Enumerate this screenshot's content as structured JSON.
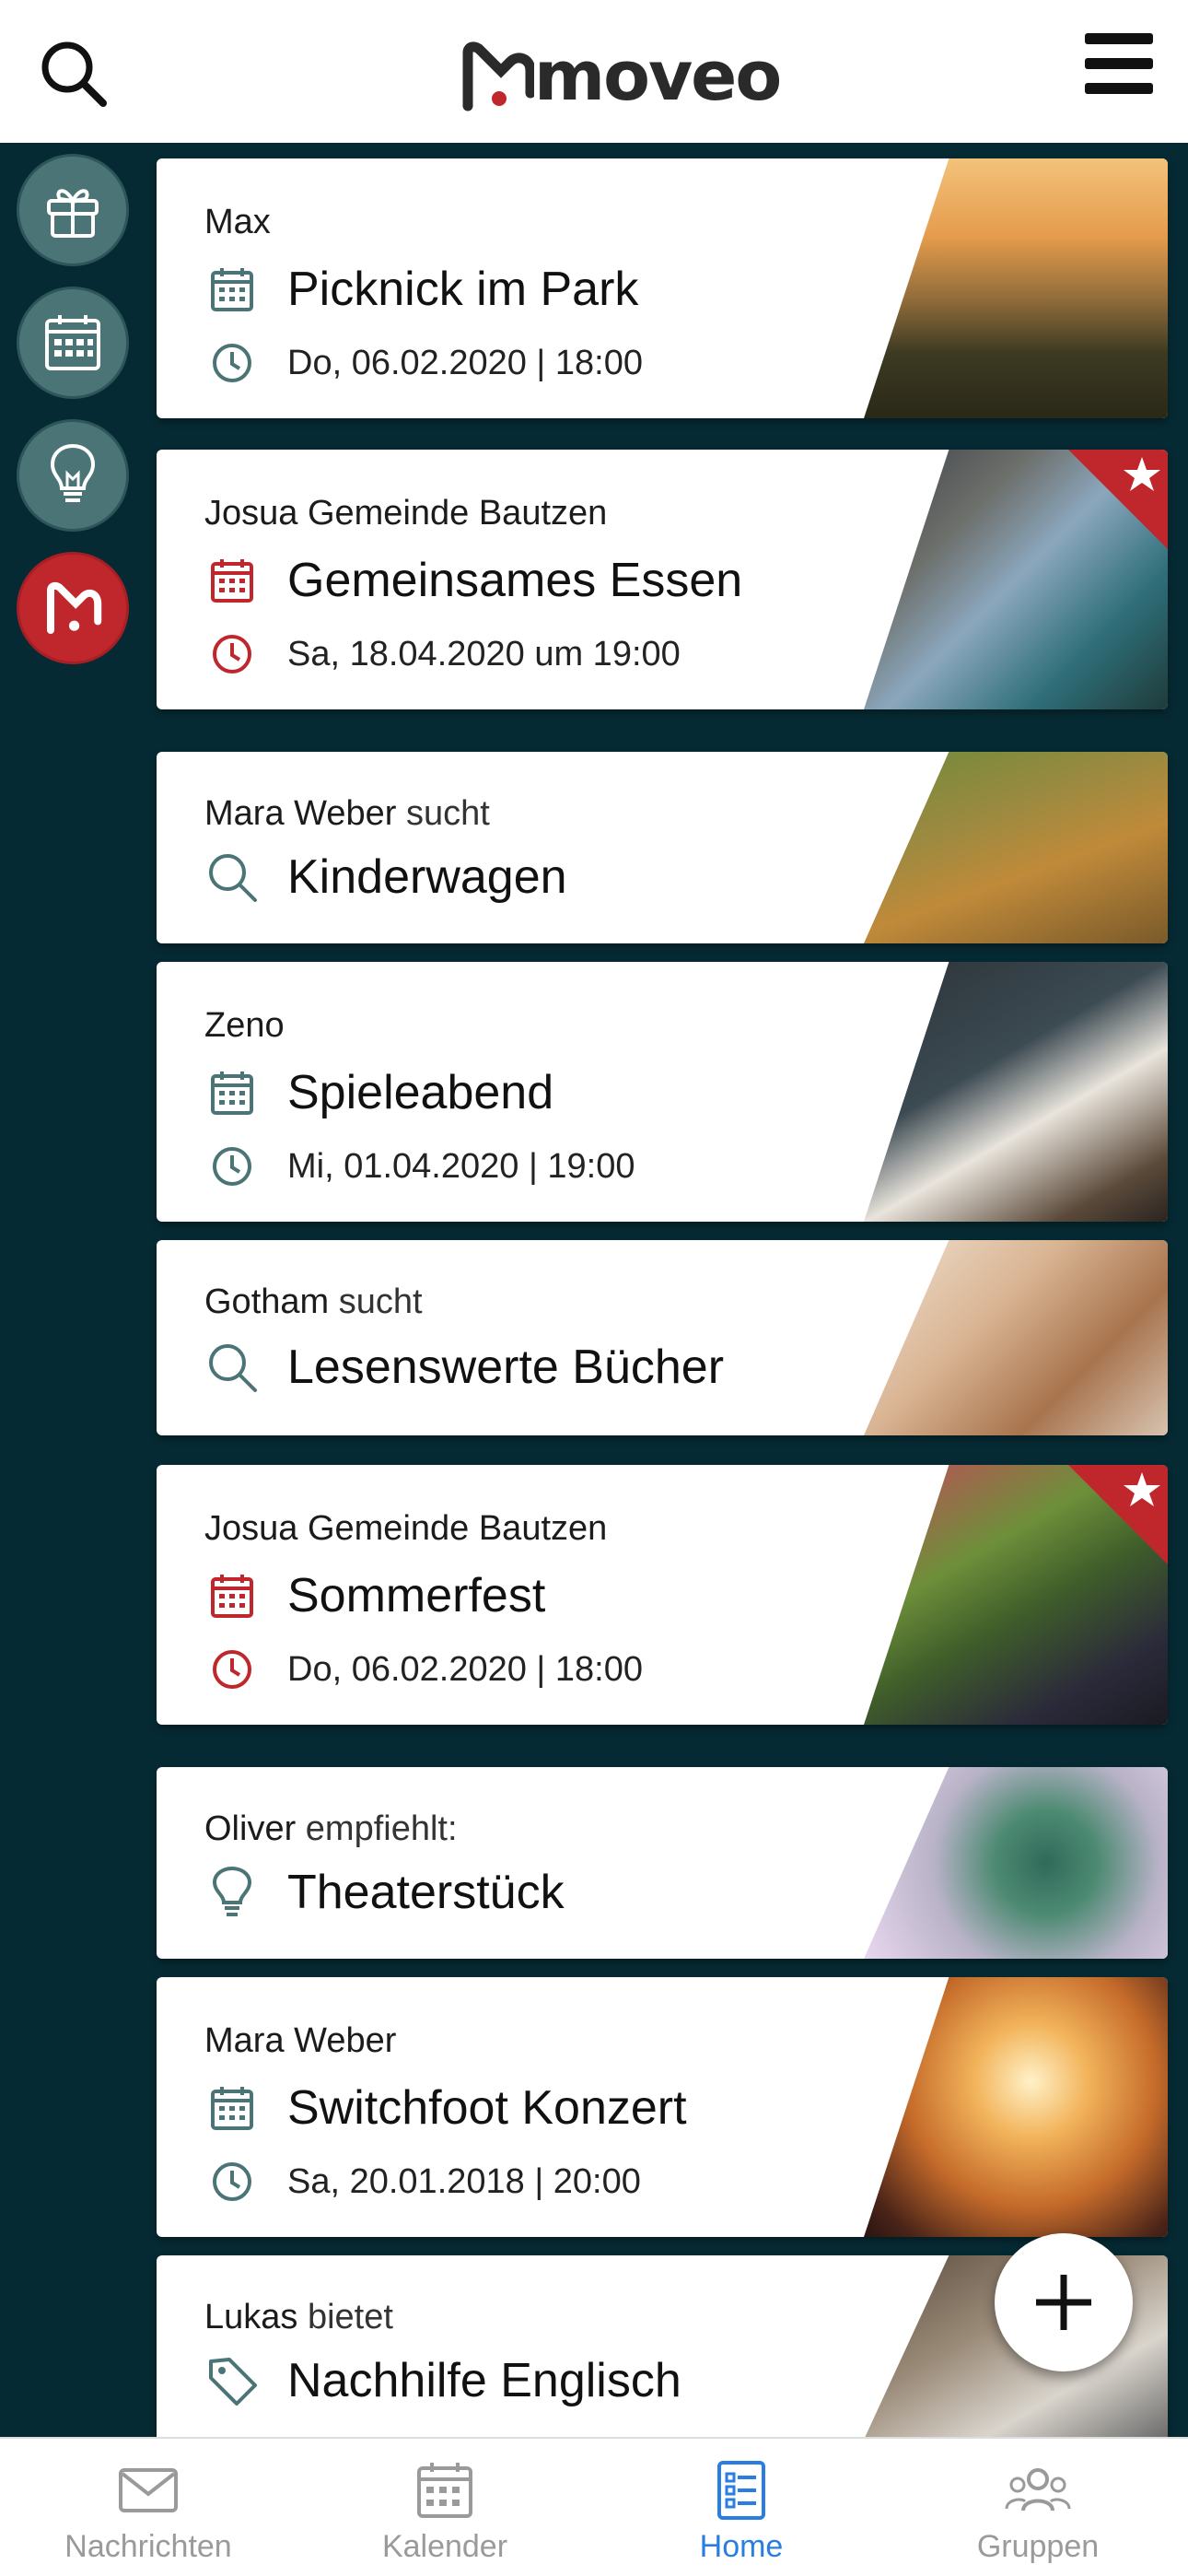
{
  "header": {
    "logo_text": "moveo",
    "search_icon": "search-icon",
    "menu_icon": "hamburger-menu-icon"
  },
  "rail": [
    {
      "name": "gift",
      "icon": "gift-icon"
    },
    {
      "name": "calendar",
      "icon": "calendar-icon"
    },
    {
      "name": "idea",
      "icon": "lightbulb-icon"
    },
    {
      "name": "moveo",
      "icon": "moveo-logo-icon",
      "active": true
    }
  ],
  "cards": [
    {
      "author": "Max",
      "verb": "",
      "type": "event",
      "title": "Picknick im Park",
      "date": "Do, 06.02.2020 | 18:00",
      "highlight": false
    },
    {
      "author": "Josua Gemeinde Bautzen",
      "verb": "",
      "type": "event",
      "title": "Gemeinsames Essen",
      "date": "Sa, 18.04.2020 um 19:00",
      "highlight": true
    },
    {
      "author": "Mara Weber",
      "verb": "sucht",
      "type": "search",
      "title": "Kinderwagen",
      "highlight": false
    },
    {
      "author": "Zeno",
      "verb": "",
      "type": "event",
      "title": "Spieleabend",
      "date": "Mi, 01.04.2020 | 19:00",
      "highlight": false
    },
    {
      "author": "Gotham",
      "verb": "sucht",
      "type": "search",
      "title": "Lesenswerte Bücher",
      "highlight": false
    },
    {
      "author": "Josua Gemeinde Bautzen",
      "verb": "",
      "type": "event",
      "title": "Sommerfest",
      "date": "Do, 06.02.2020 | 18:00",
      "highlight": true
    },
    {
      "author": "Oliver",
      "verb": "empfiehlt:",
      "type": "recommend",
      "title": "Theaterstück",
      "highlight": false
    },
    {
      "author": "Mara Weber",
      "verb": "",
      "type": "event",
      "title": "Switchfoot Konzert",
      "date": "Sa, 20.01.2018 | 20:00",
      "highlight": false
    },
    {
      "author": "Lukas",
      "verb": "bietet",
      "type": "offer",
      "title": "Nachhilfe Englisch",
      "highlight": false
    }
  ],
  "nav": [
    {
      "label": "Nachrichten",
      "icon": "mail-icon"
    },
    {
      "label": "Kalender",
      "icon": "calendar-icon"
    },
    {
      "label": "Home",
      "icon": "list-icon",
      "active": true
    },
    {
      "label": "Gruppen",
      "icon": "groups-icon"
    }
  ],
  "colors": {
    "background": "#062a33",
    "accent_red": "#c0272d",
    "teal_icon": "#4b7477",
    "nav_active": "#2a7de1"
  }
}
